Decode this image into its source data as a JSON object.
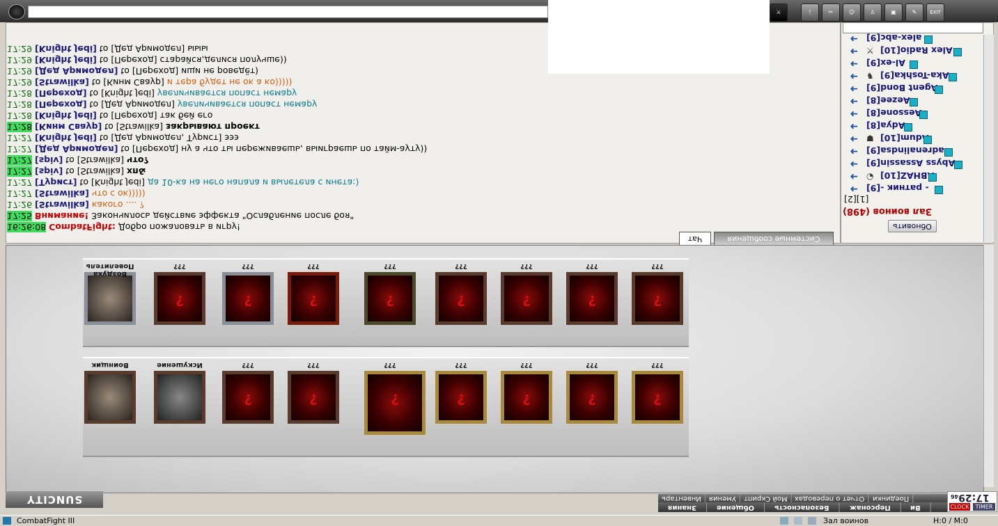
{
  "window": {
    "title": "CombatFight III"
  },
  "chat": {
    "tabs": [
      "Чат",
      "Системные сообщения"
    ],
    "messages": [
      {
        "time": "17:29",
        "nick": "[Knight Jedi]",
        "to": "to [Дед Аримодел]",
        "text": "ыыы",
        "style": "plain",
        "hl": false
      },
      {
        "time": "17:29",
        "nick": "[Knight Jedi]",
        "to": "to [Переход]",
        "text": "старайся,делися получше))",
        "style": "plain",
        "hl": false
      },
      {
        "time": "17:29",
        "nick": "[Дед Аримодел]",
        "to": "to [Переход]",
        "text": "ищи не роведёт)",
        "style": "plain",
        "hl": false
      },
      {
        "time": "17:29",
        "nick": "[Strawilka]",
        "to": "to [Кинм Сваур]",
        "text": "и тера будет не ок а ко)))))",
        "style": "orange",
        "hl": false
      },
      {
        "time": "17:28",
        "nick": "[Переход]",
        "to": "to [Knight Jedi]",
        "text": "увеличивается попаст немару",
        "style": "teal",
        "hl": false
      },
      {
        "time": "17:28",
        "nick": "[Переход]",
        "to": "to [Дед Аримодел]",
        "text": "увеличивается попаст немару",
        "style": "teal",
        "hl": false
      },
      {
        "time": "17:28",
        "nick": "[Knight Jedi]",
        "to": "to [Переход]",
        "text": "так бей его",
        "style": "plain",
        "hl": false
      },
      {
        "time": "17:28",
        "nick": "[Кинм Сваур]",
        "to": "to [Strawilka]",
        "text": "закрывают проект",
        "style": "bold",
        "hl": true
      },
      {
        "time": "17:27",
        "nick": "[Knight Jedi]",
        "to": "to [Дед Аримодел, Турист]",
        "text": "эээ",
        "style": "plain",
        "hl": false
      },
      {
        "time": "17:27",
        "nick": "[Дед Аримодел]",
        "to": "to [Переход]",
        "text": "ну а что ты переживаешь, выиграешь по тайм-ауту))",
        "style": "plain",
        "hl": false
      },
      {
        "time": "17:27",
        "nick": "[spiv]",
        "to": "to [Strawilka]",
        "text": "что?",
        "style": "bold",
        "hl": true
      },
      {
        "time": "17:27",
        "nick": "[spiv]",
        "to": "to [Strawilka]",
        "text": "хп&",
        "style": "bold",
        "hl": true
      },
      {
        "time": "17:27",
        "nick": "[Турист]",
        "to": "to [Knight Jedi]",
        "text": "да 10-ка на него напала и вылетела с инета:)",
        "style": "teal",
        "hl": false
      },
      {
        "time": "17:27",
        "nick": "[Strawilka]",
        "to": "",
        "text": "что с ок)))))",
        "style": "orange",
        "hl": false
      },
      {
        "time": "17:26",
        "nick": "[Strawilka]",
        "to": "",
        "text": "какого .... ?",
        "style": "orange",
        "hl": false
      },
      {
        "time": "17:25",
        "nick": "Внимание!",
        "to": "",
        "text": "Закончилось действие эффекта \"Ослабление после боя\"",
        "style": "plain",
        "hl": true
      },
      {
        "time": "16:26:08",
        "nick": "CombatFight:",
        "to": "",
        "text": "Добро пожаловать в игру!",
        "style": "plain",
        "hl": true
      }
    ]
  },
  "players": {
    "list": [
      {
        "name": "alex-abc[9]",
        "pic": ""
      },
      {
        "name": "Alex Radio[10]",
        "pic": "⚔"
      },
      {
        "name": "Al-ex[9]",
        "pic": ""
      },
      {
        "name": "Aka-Toshka[9]",
        "pic": "♞"
      },
      {
        "name": "Agent Bond[9]",
        "pic": ""
      },
      {
        "name": "Aezee[8]",
        "pic": ""
      },
      {
        "name": "Aessone[8]",
        "pic": ""
      },
      {
        "name": "Adya[8]",
        "pic": ""
      },
      {
        "name": "Adum[10]",
        "pic": "☗"
      },
      {
        "name": "adrenalindsa[9]",
        "pic": ""
      },
      {
        "name": "Abyss Assassin[9]",
        "pic": ""
      },
      {
        "name": "ABHAZ[10]",
        "pic": "◔"
      },
      {
        "name": "- ратник -[9]",
        "pic": ""
      }
    ],
    "pager": "[1][2]",
    "hall_title": "Зал воинов (498)",
    "refresh_label": "Обновить"
  },
  "arena": {
    "top_row": [
      {
        "label": "Воздуха Повелитель",
        "frame": "silver",
        "photo": true
      },
      {
        "label": "???",
        "frame": "brown",
        "photo": false
      },
      {
        "label": "???",
        "frame": "silver",
        "photo": false
      },
      {
        "label": "???",
        "frame": "red",
        "photo": false
      },
      {
        "label": "???",
        "frame": "olive",
        "photo": false
      },
      {
        "label": "???",
        "frame": "brown",
        "photo": false
      },
      {
        "label": "???",
        "frame": "brown",
        "photo": false
      },
      {
        "label": "???",
        "frame": "brown",
        "photo": false
      },
      {
        "label": "???",
        "frame": "brown",
        "photo": false
      }
    ],
    "bottom_row": [
      {
        "label": "Воинщик",
        "frame": "brown",
        "photo": true
      },
      {
        "label": "Искушение",
        "frame": "brown",
        "photo": true
      },
      {
        "label": "???",
        "frame": "brown",
        "photo": false
      },
      {
        "label": "???",
        "frame": "brown",
        "photo": false
      },
      {
        "label": "???",
        "frame": "gold",
        "photo": false
      },
      {
        "label": "???",
        "frame": "gold",
        "photo": false
      },
      {
        "label": "???",
        "frame": "gold",
        "photo": false
      },
      {
        "label": "???",
        "frame": "gold",
        "photo": false
      },
      {
        "label": "???",
        "frame": "gold",
        "photo": false
      }
    ]
  },
  "menu": {
    "row1": [
      "Инвентарь",
      "Умения",
      "Мой Скрипт",
      "Отчет о переводах",
      "Поединки"
    ],
    "row2": [
      "Знания",
      "Общение",
      "Безопасность",
      "Персонаж",
      "Ви"
    ],
    "logo": "SUNCITY"
  },
  "clock": {
    "time": "17:29",
    "sec": "46",
    "clock_label": "CLOCK",
    "timer_label": "TIMER"
  },
  "status": {
    "left": "CombatFight III",
    "hall": "Зал воинов",
    "hp": "H:0 / M:0"
  },
  "toolbar": {
    "exit_label": "EXIT"
  }
}
